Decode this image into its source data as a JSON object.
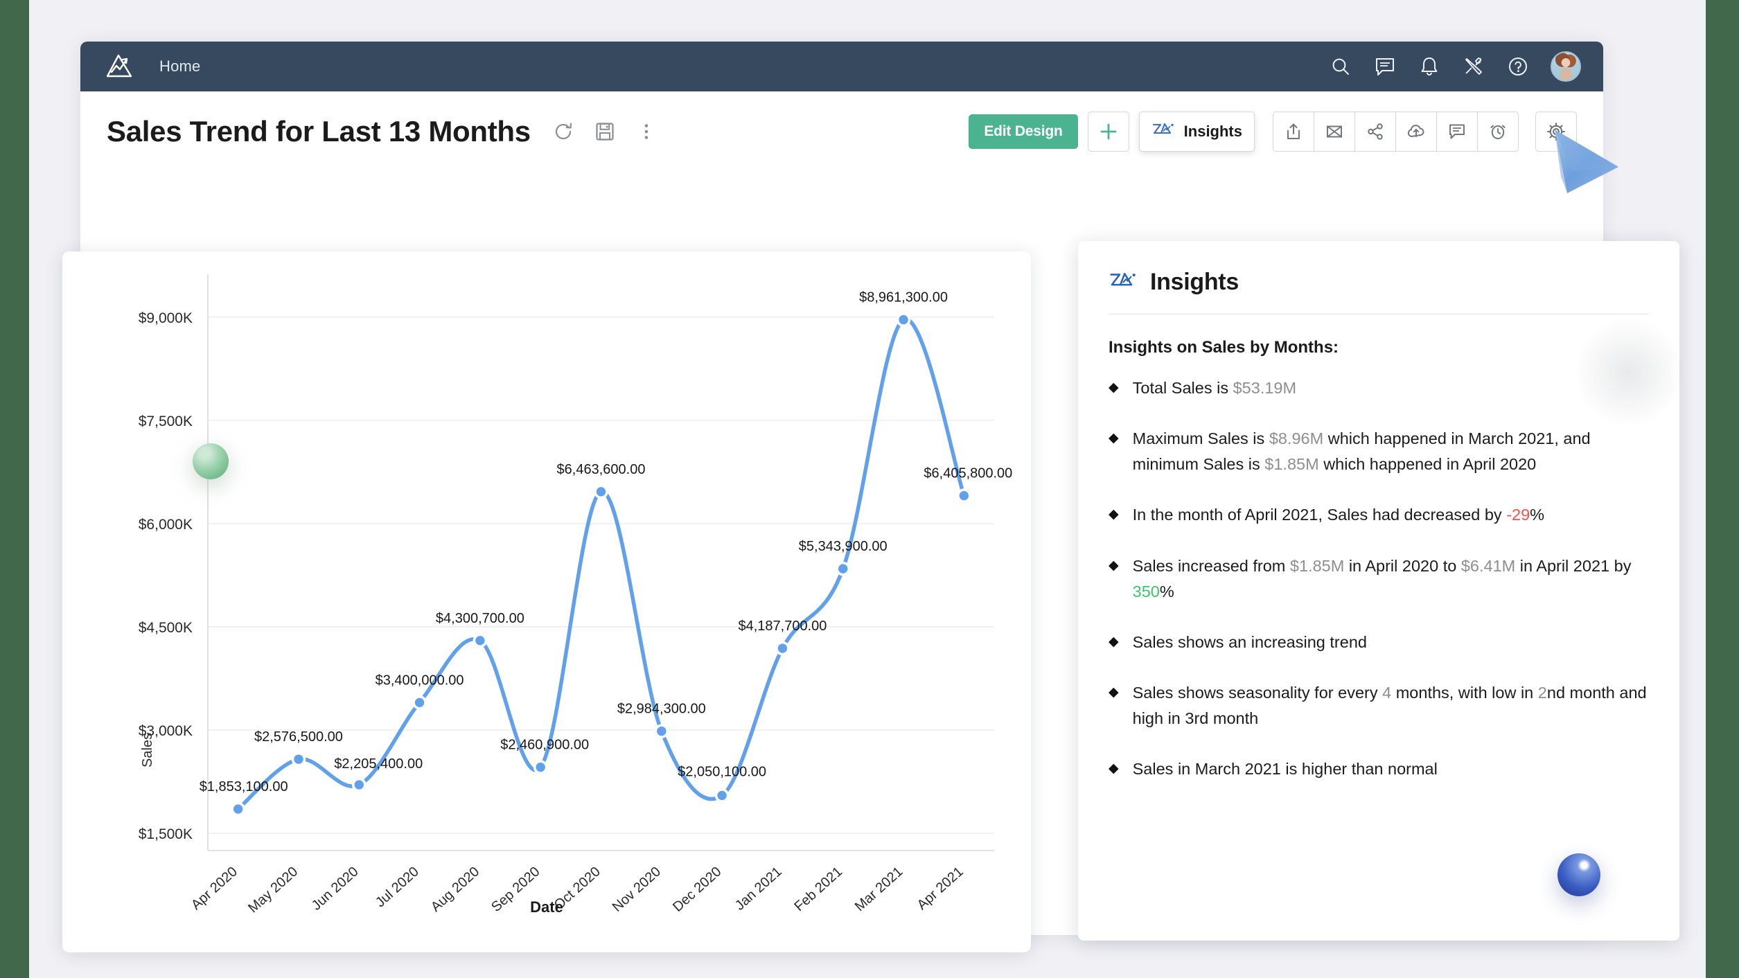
{
  "navbar": {
    "home_label": "Home",
    "icons": [
      "search-icon",
      "chat-icon",
      "bell-icon",
      "tools-icon",
      "help-icon",
      "avatar"
    ]
  },
  "header": {
    "title": "Sales Trend for Last 13 Months",
    "title_icons": [
      "refresh-icon",
      "save-icon",
      "more-vertical-icon"
    ]
  },
  "toolbar": {
    "edit_design_label": "Edit Design",
    "add_label": "+",
    "insights_label": "Insights",
    "icons": [
      "export-icon",
      "email-icon",
      "share-icon",
      "publish-icon",
      "comment-icon",
      "alarm-icon",
      "settings-icon"
    ],
    "accent_green": "#4cb391"
  },
  "insights": {
    "panel_title": "Insights",
    "subtitle": "Insights on Sales by Months:",
    "items": [
      {
        "parts": [
          {
            "t": "Total Sales is ",
            "s": "n"
          },
          {
            "t": "$53.19M",
            "s": "hl"
          }
        ]
      },
      {
        "parts": [
          {
            "t": "Maximum Sales is ",
            "s": "n"
          },
          {
            "t": "$8.96M",
            "s": "hl"
          },
          {
            "t": " which happened in March 2021, and minimum Sales is ",
            "s": "n"
          },
          {
            "t": "$1.85M",
            "s": "hl"
          },
          {
            "t": " which happened  in April 2020",
            "s": "n"
          }
        ]
      },
      {
        "parts": [
          {
            "t": " In the month of April 2021, Sales had decreased by ",
            "s": "n"
          },
          {
            "t": "-29",
            "s": "neg"
          },
          {
            "t": "%",
            "s": "n"
          }
        ]
      },
      {
        "parts": [
          {
            "t": "Sales increased from ",
            "s": "n"
          },
          {
            "t": " $1.85M",
            "s": "hl"
          },
          {
            "t": " in April 2020 to ",
            "s": "n"
          },
          {
            "t": "$6.41M",
            "s": "hl"
          },
          {
            "t": " in April 2021 by ",
            "s": "n"
          },
          {
            "t": "350",
            "s": "pos"
          },
          {
            "t": "%",
            "s": "n"
          }
        ]
      },
      {
        "parts": [
          {
            "t": "Sales shows an increasing trend",
            "s": "n"
          }
        ]
      },
      {
        "parts": [
          {
            "t": "Sales shows seasonality for every ",
            "s": "n"
          },
          {
            "t": "4",
            "s": "hl"
          },
          {
            "t": " months, with low in ",
            "s": "n"
          },
          {
            "t": "2",
            "s": "hl"
          },
          {
            "t": "nd month and high in 3rd month",
            "s": "n"
          }
        ]
      },
      {
        "parts": [
          {
            "t": "Sales in March 2021 is higher than normal",
            "s": "n"
          }
        ]
      }
    ]
  },
  "chart_data": {
    "type": "line",
    "title": "Sales Trend for Last 13 Months",
    "xlabel": "Date",
    "ylabel": "Sales",
    "categories": [
      "Apr 2020",
      "May 2020",
      "Jun 2020",
      "Jul 2020",
      "Aug 2020",
      "Sep 2020",
      "Oct 2020",
      "Nov 2020",
      "Dec 2020",
      "Jan 2021",
      "Feb 2021",
      "Mar 2021",
      "Apr 2021"
    ],
    "values": [
      1853100,
      2576500,
      2205400,
      3400000,
      4300700,
      2460900,
      6463600,
      2984300,
      2050100,
      4187700,
      5343900,
      8961300,
      6405800
    ],
    "point_labels": [
      "$1,853,100.00",
      "$2,576,500.00",
      "$2,205,400.00",
      "$3,400,000.00",
      "$4,300,700.00",
      "$2,460,900.00",
      "$6,463,600.00",
      "$2,984,300.00",
      "$2,050,100.00",
      "$4,187,700.00",
      "$5,343,900.00",
      "$8,961,300.00",
      "$6,405,800.00"
    ],
    "yticks": [
      1500000,
      3000000,
      4500000,
      6000000,
      7500000,
      9000000
    ],
    "ytick_labels": [
      "$1,500K",
      "$3,000K",
      "$4,500K",
      "$6,000K",
      "$7,500K",
      "$9,000K"
    ],
    "ylim": [
      1250000,
      9400000
    ],
    "grid": true,
    "legend": "none",
    "series_color": "#61a0ea"
  }
}
